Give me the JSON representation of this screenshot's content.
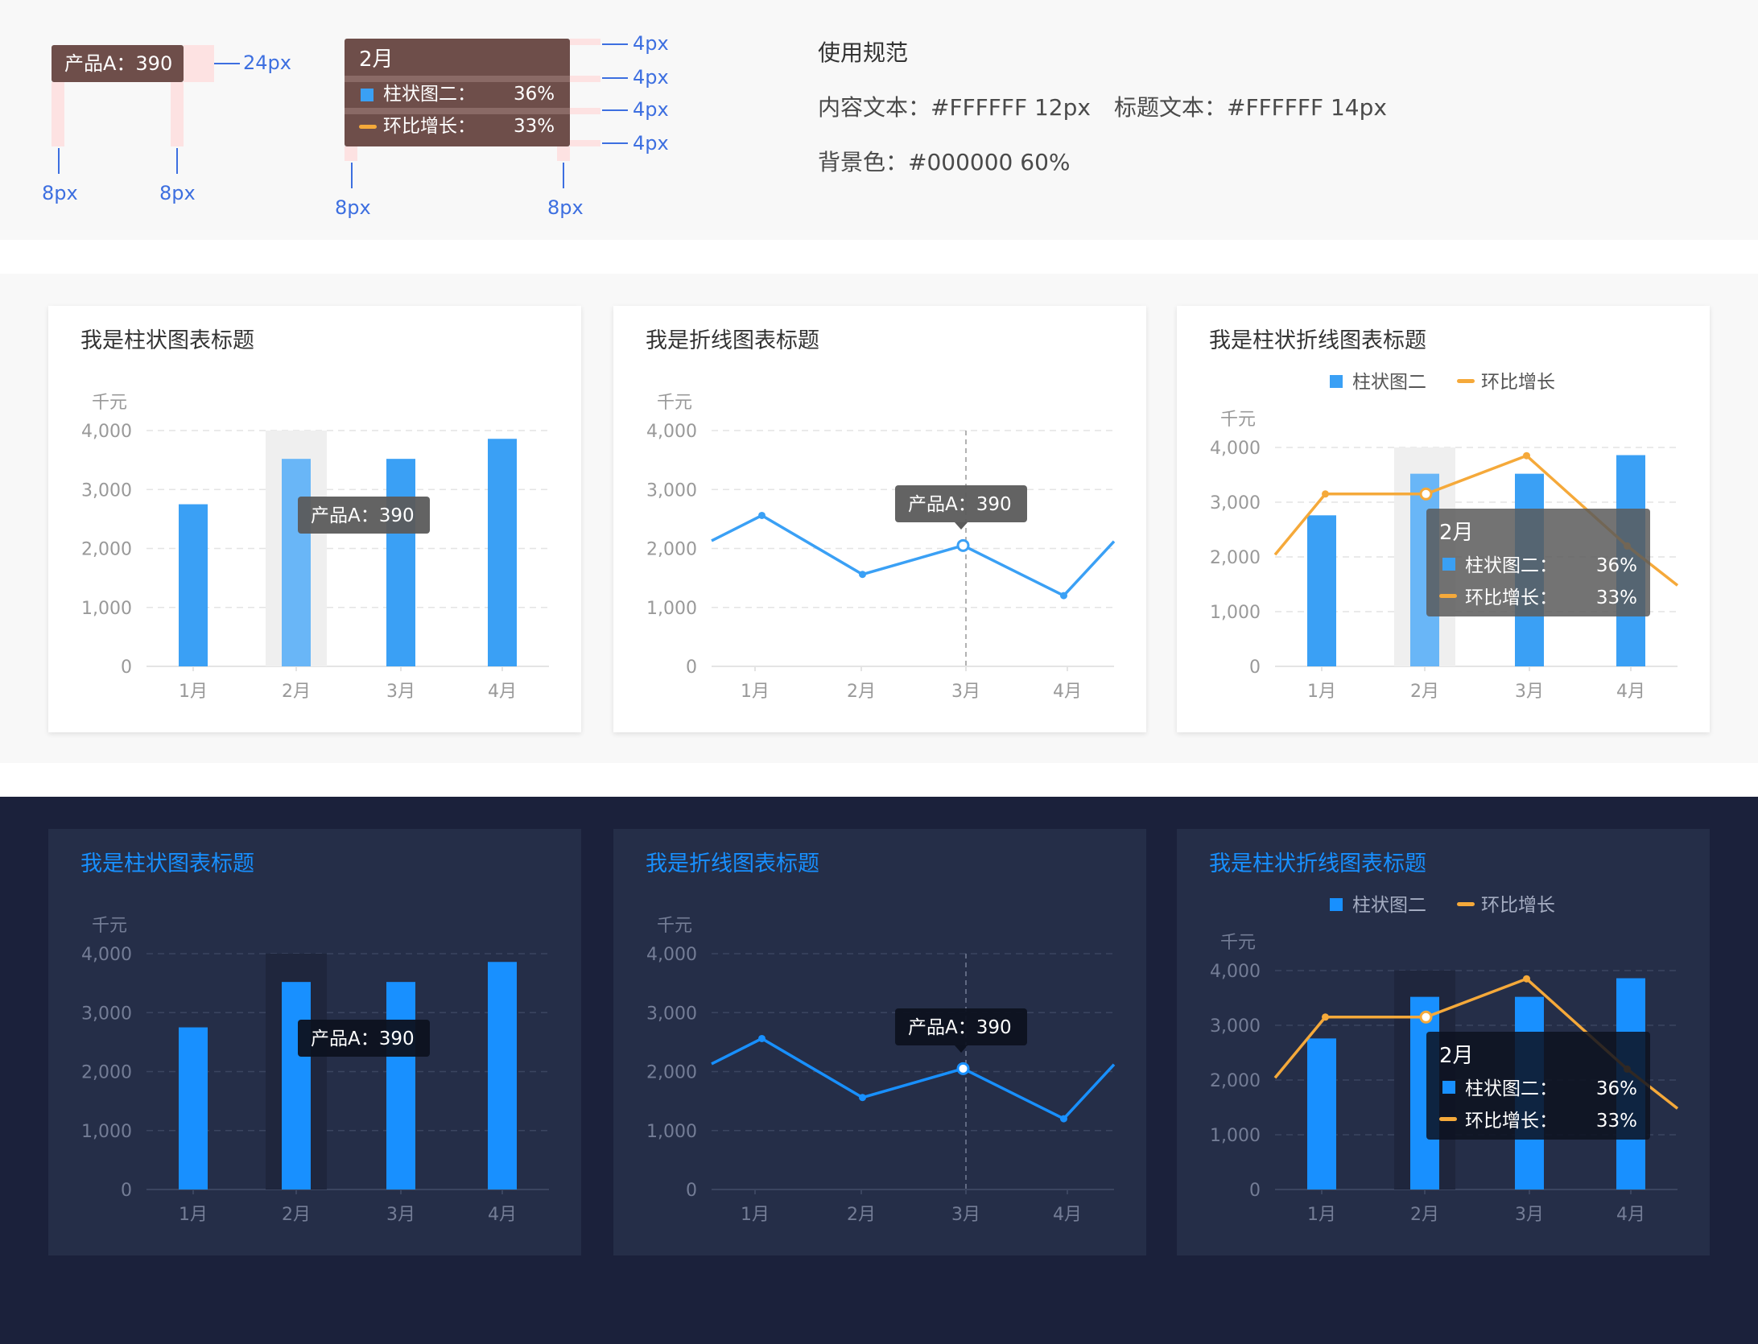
{
  "spec": {
    "simple_tooltip": {
      "text": "产品A：390",
      "height_label": "24px",
      "pad_left_label": "8px",
      "pad_right_label": "8px"
    },
    "multi_tooltip": {
      "title": "2月",
      "rows": [
        {
          "label": "柱状图二：",
          "value": "36%",
          "marker": "square",
          "color": "#3aa0f5"
        },
        {
          "label": "环比增长：",
          "value": "33%",
          "marker": "line",
          "color": "#f5a93a"
        }
      ],
      "gap_labels": [
        "4px",
        "4px",
        "4px",
        "4px"
      ],
      "pad_left_label": "8px",
      "pad_right_label": "8px"
    },
    "usage": {
      "heading": "使用规范",
      "content_text": "内容文本：#FFFFFF 12px",
      "title_text": "标题文本：#FFFFFF 14px",
      "bg_text": "背景色：#000000 60%"
    }
  },
  "themes": {
    "light": {
      "title_color": "#333333",
      "axis_text": "#999999",
      "grid": "#e4e4e4",
      "bar": "#3aa0f5",
      "bar_hover": "#69b6f7",
      "line": "#3aa0f5",
      "growth": "#f5a93a",
      "highlight": "#efefef",
      "tip_bg": "#5b5b5b"
    },
    "dark": {
      "title_color": "#1890ff",
      "axis_text": "#747d96",
      "grid": "#3b4560",
      "bar": "#1890ff",
      "bar_hover": "#1890ff",
      "line": "#1890ff",
      "growth": "#f5a93a",
      "highlight": "#1f263d",
      "tip_bg": "#0d1220"
    }
  },
  "charts": {
    "light_bar": {
      "title": "我是柱状图表标题",
      "unit": "千元",
      "tooltip": "产品A：390"
    },
    "light_line": {
      "title": "我是折线图表标题",
      "unit": "千元",
      "tooltip": "产品A：390"
    },
    "light_combo": {
      "title": "我是柱状折线图表标题",
      "unit": "千元",
      "legend": [
        "柱状图二",
        "环比增长"
      ],
      "tooltip_title": "2月",
      "tooltip_rows": [
        {
          "label": "柱状图二：",
          "value": "36%"
        },
        {
          "label": "环比增长：",
          "value": "33%"
        }
      ]
    },
    "dark_bar": {
      "title": "我是柱状图表标题",
      "unit": "千元",
      "tooltip": "产品A：390"
    },
    "dark_line": {
      "title": "我是折线图表标题",
      "unit": "千元",
      "tooltip": "产品A：390"
    },
    "dark_combo": {
      "title": "我是柱状折线图表标题",
      "unit": "千元",
      "legend": [
        "柱状图二",
        "环比增长"
      ],
      "tooltip_title": "2月",
      "tooltip_rows": [
        {
          "label": "柱状图二：",
          "value": "36%"
        },
        {
          "label": "环比增长：",
          "value": "33%"
        }
      ]
    }
  },
  "chart_data": [
    {
      "type": "bar",
      "title": "我是柱状图表标题",
      "ylabel": "千元",
      "categories": [
        "1月",
        "2月",
        "3月",
        "4月"
      ],
      "values": [
        2750,
        3520,
        3520,
        3860
      ],
      "ylim": [
        0,
        4000
      ],
      "yticks": [
        "0",
        "1,000",
        "2,000",
        "3,000",
        "4,000"
      ],
      "grid": true,
      "highlight": "2月"
    },
    {
      "type": "line",
      "title": "我是折线图表标题",
      "ylabel": "千元",
      "categories": [
        "1月",
        "2月",
        "3月",
        "4月"
      ],
      "x": [
        0.0,
        0.5,
        1.5,
        2.5,
        3.5,
        4.0
      ],
      "values": [
        2130,
        2560,
        1560,
        2050,
        1200,
        2120
      ],
      "ylim": [
        0,
        4000
      ],
      "yticks": [
        "0",
        "1,000",
        "2,000",
        "3,000",
        "4,000"
      ],
      "grid": true,
      "highlight": "3月"
    },
    {
      "type": "bar",
      "title": "我是柱状折线图表标题",
      "ylabel": "千元",
      "categories": [
        "1月",
        "2月",
        "3月",
        "4月"
      ],
      "series": [
        {
          "name": "柱状图二",
          "type": "bar",
          "values": [
            2760,
            3520,
            3520,
            3860
          ]
        },
        {
          "name": "环比增长",
          "type": "line",
          "x": [
            0.0,
            0.5,
            1.5,
            2.5,
            3.5,
            4.0
          ],
          "values": [
            2040,
            3150,
            3150,
            3850,
            2200,
            1480
          ]
        }
      ],
      "ylim": [
        0,
        4000
      ],
      "yticks": [
        "0",
        "1,000",
        "2,000",
        "3,000",
        "4,000"
      ],
      "grid": true,
      "legend": "top-center",
      "highlight": "2月"
    }
  ]
}
